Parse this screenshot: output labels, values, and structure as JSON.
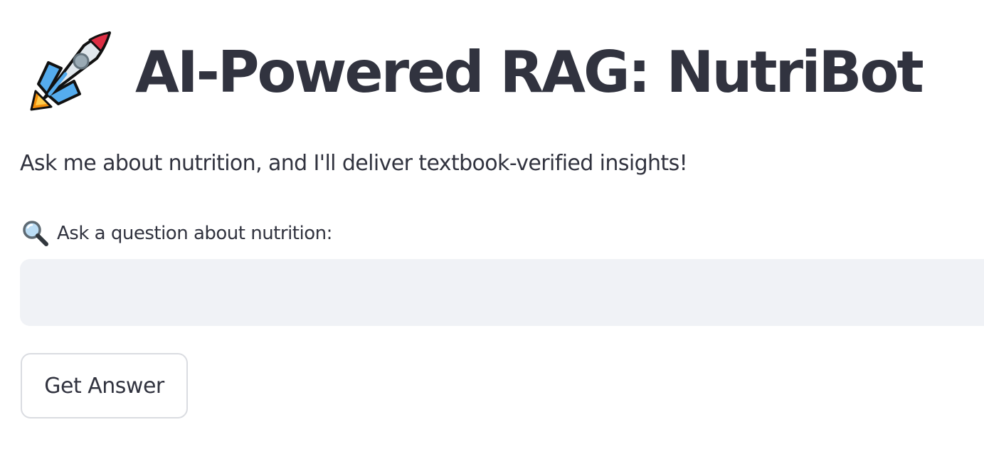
{
  "header": {
    "title": "AI-Powered RAG: NutriBot",
    "title_icon": "rocket-icon"
  },
  "intro": {
    "text": "Ask me about nutrition, and I'll deliver textbook-verified insights!"
  },
  "question": {
    "label": "Ask a question about nutrition:",
    "label_icon": "magnifying-glass-icon",
    "value": "",
    "placeholder": ""
  },
  "actions": {
    "submit_label": "Get Answer"
  },
  "colors": {
    "text": "#31333F",
    "input_background": "#F0F2F6",
    "button_border": "#DADCE1",
    "background": "#FFFFFF"
  }
}
